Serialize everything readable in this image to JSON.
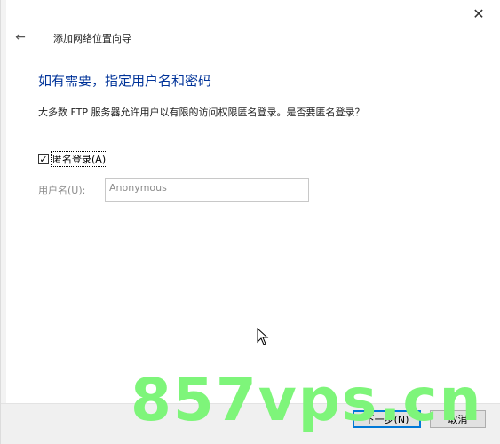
{
  "window": {
    "close_glyph": "✕",
    "back_glyph": "←",
    "title": "添加网络位置向导"
  },
  "content": {
    "heading": "如有需要，指定用户名和密码",
    "question": "大多数 FTP 服务器允许用户以有限的访问权限匿名登录。是否要匿名登录？",
    "anonymous_checkbox": {
      "label": "匿名登录(A)",
      "checked": true,
      "check_glyph": "✓"
    },
    "username": {
      "label": "用户名(U):",
      "value": "Anonymous"
    }
  },
  "footer": {
    "next_label": "下一步(N)",
    "cancel_label": "取消"
  },
  "watermark": "857vps.cn"
}
